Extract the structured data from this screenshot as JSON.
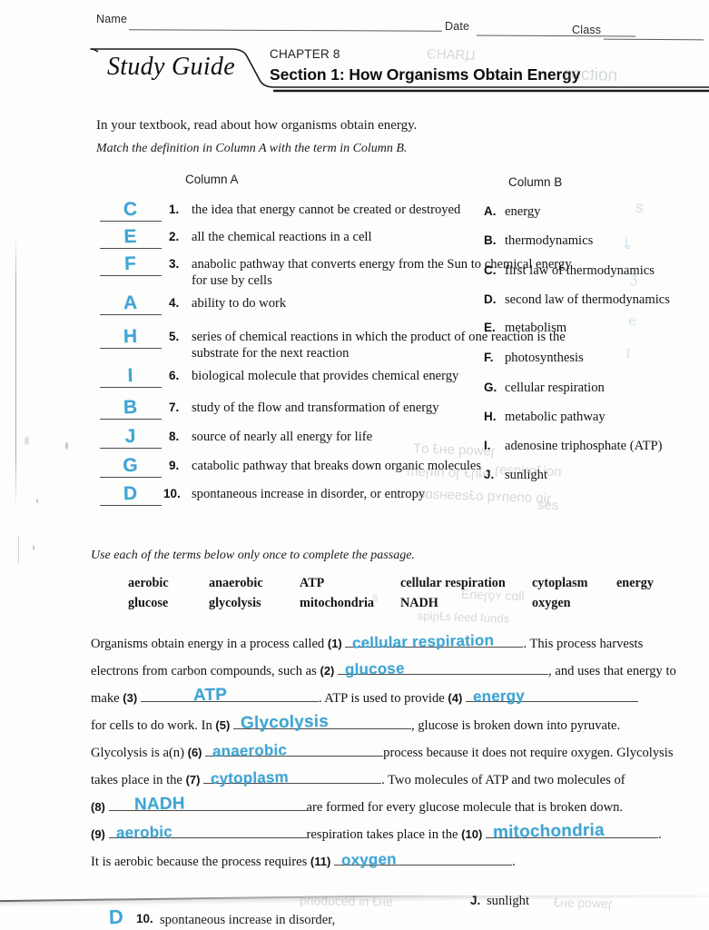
{
  "header": {
    "name_label": "Name",
    "date_label": "Date",
    "class_label": "Class",
    "tab_title": "Study Guide",
    "chapter": "CHAPTER 8",
    "section": "Section 1: How Organisms Obtain Energy"
  },
  "intro": {
    "line1": "In your textbook, read about how organisms obtain energy.",
    "line2": "Match the definition in Column A with the term in Column B.",
    "column_a_header": "Column A",
    "column_b_header": "Column B"
  },
  "matching": {
    "items": [
      {
        "num": "1.",
        "answer": "C",
        "text": "the idea that energy cannot be created or destroyed"
      },
      {
        "num": "2.",
        "answer": "E",
        "text": "all the chemical reactions in a cell"
      },
      {
        "num": "3.",
        "answer": "F",
        "text": "anabolic pathway that converts energy from the Sun to chemical energy for use by cells"
      },
      {
        "num": "4.",
        "answer": "A",
        "text": "ability to do work"
      },
      {
        "num": "5.",
        "answer": "H",
        "text": "series of chemical reactions in which the product of one reaction is the substrate for the next reaction"
      },
      {
        "num": "6.",
        "answer": "I",
        "text": "biological molecule that provides chemical energy"
      },
      {
        "num": "7.",
        "answer": "B",
        "text": "study of the flow and transformation of energy"
      },
      {
        "num": "8.",
        "answer": "J",
        "text": "source of nearly all energy for life"
      },
      {
        "num": "9.",
        "answer": "G",
        "text": "catabolic pathway that breaks down organic molecules"
      },
      {
        "num": "10.",
        "answer": "D",
        "text": "spontaneous increase in disorder, or entropy"
      }
    ],
    "terms": [
      {
        "letter": "A.",
        "text": "energy"
      },
      {
        "letter": "B.",
        "text": "thermodynamics"
      },
      {
        "letter": "C.",
        "text": "first law of thermodynamics"
      },
      {
        "letter": "D.",
        "text": "second law of thermodynamics"
      },
      {
        "letter": "E.",
        "text": "metabolism"
      },
      {
        "letter": "F.",
        "text": "photosynthesis"
      },
      {
        "letter": "G.",
        "text": "cellular respiration"
      },
      {
        "letter": "H.",
        "text": "metabolic pathway"
      },
      {
        "letter": "I.",
        "text": "adenosine triphosphate (ATP)"
      },
      {
        "letter": "J.",
        "text": "sunlight"
      }
    ]
  },
  "passage": {
    "instruction": "Use each of the terms below only once to complete the passage.",
    "word_bank_row1": [
      "aerobic",
      "anaerobic",
      "ATP",
      "cellular respiration",
      "cytoplasm",
      "energy"
    ],
    "word_bank_row2": [
      "glucose",
      "glycolysis",
      "mitochondria",
      "NADH",
      "oxygen"
    ],
    "seg": {
      "s1": "Organisms obtain energy in a process called",
      "s2": ". This process harvests",
      "s3": "electrons from carbon compounds, such as",
      "s4": ", and uses that energy to",
      "s5": "make",
      "s6": ". ATP is used to provide",
      "s7": "for cells to do work. In",
      "s8": ", glucose is broken down into pyruvate.",
      "s9": "Glycolysis is a(n)",
      "s10": "process because it does not require oxygen. Glycolysis",
      "s11": "takes place in the",
      "s12": ". Two molecules of ATP and two molecules of",
      "s13": "are formed for every glucose molecule that is broken down.",
      "s14": "respiration takes place in the",
      "s15": ".",
      "s16": "It is aerobic because the process requires",
      "s17": "."
    },
    "blanks": [
      {
        "num": "(1)",
        "answer": "cellular respiration"
      },
      {
        "num": "(2)",
        "answer": "glucose"
      },
      {
        "num": "(3)",
        "answer": "ATP"
      },
      {
        "num": "(4)",
        "answer": "energy"
      },
      {
        "num": "(5)",
        "answer": "Glycolysis"
      },
      {
        "num": "(6)",
        "answer": "anaerobic"
      },
      {
        "num": "(7)",
        "answer": "cytoplasm"
      },
      {
        "num": "(8)",
        "answer": "NADH"
      },
      {
        "num": "(9)",
        "answer": "aerobic"
      },
      {
        "num": "(10)",
        "answer": "mitochondria"
      },
      {
        "num": "(11)",
        "answer": "oxygen"
      }
    ]
  },
  "artifact": {
    "answer": "D",
    "num": "10.",
    "text": "spontaneous increase in disorder,",
    "sun_letter": "J.",
    "sun_text": "sunlight"
  },
  "colors": {
    "ink": "#3fa5d4",
    "print": "#141414",
    "rule": "#4a4a4a"
  }
}
